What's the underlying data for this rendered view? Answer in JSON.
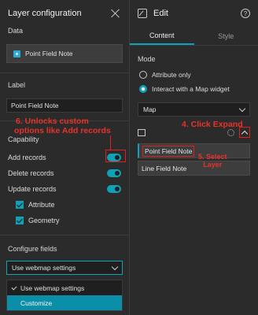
{
  "left_panel": {
    "title": "Layer configuration",
    "data_label": "Data",
    "data_value": "Point Field Note",
    "label_section": "Label",
    "label_value": "Point Field Note",
    "capability_label": "Capability",
    "toggles": [
      {
        "label": "Add records",
        "on": true
      },
      {
        "label": "Delete records",
        "on": true
      },
      {
        "label": "Update records",
        "on": true
      }
    ],
    "checks": [
      {
        "label": "Attribute",
        "checked": true
      },
      {
        "label": "Geometry",
        "checked": true
      }
    ],
    "configure_fields_label": "Configure fields",
    "select_value": "Use webmap settings",
    "dropdown_options": [
      "Use webmap settings",
      "Customize"
    ]
  },
  "right_panel": {
    "title": "Edit",
    "help": "?",
    "tabs": [
      "Content",
      "Style"
    ],
    "mode_label": "Mode",
    "radios": [
      "Attribute only",
      "Interact with a Map widget"
    ],
    "map_select": "Map",
    "layers": [
      "Point Field Note",
      "Line Field Note"
    ]
  },
  "annotations": {
    "a6_line1": "6. Unlocks custom",
    "a6_line2": "options like Add records",
    "a4": "4. Click Expand",
    "a5_line1": "5. Select",
    "a5_line2": "Layer"
  },
  "colors": {
    "accent": "#0ea1b8",
    "annotation": "#e8332b",
    "panel": "#2b2b2b"
  }
}
